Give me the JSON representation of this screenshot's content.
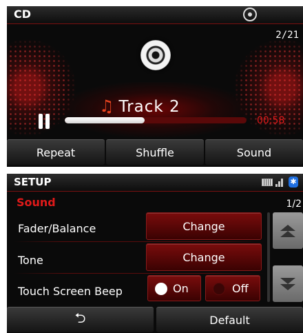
{
  "cd": {
    "title": "CD",
    "track_count": "2/21",
    "track_label": "Track  2",
    "note_icon": "♫",
    "elapsed": "00:58",
    "progress_fraction": 0.44,
    "buttons": [
      "Repeat",
      "Shuffle",
      "Sound"
    ]
  },
  "setup": {
    "title": "SETUP",
    "section": "Sound",
    "page": "1/2",
    "rows": [
      {
        "label": "Fader/Balance",
        "button": "Change"
      },
      {
        "label": "Tone",
        "button": "Change"
      },
      {
        "label": "Touch Screen Beep",
        "on_label": "On",
        "off_label": "Off",
        "selected": "On"
      }
    ],
    "back_icon": "⮌",
    "default_label": "Default",
    "bluetooth_icon": "✱"
  },
  "colors": {
    "accent_red": "#e01a1a",
    "note_orange": "#e8431f",
    "bluetooth_blue": "#1f6fe0"
  }
}
